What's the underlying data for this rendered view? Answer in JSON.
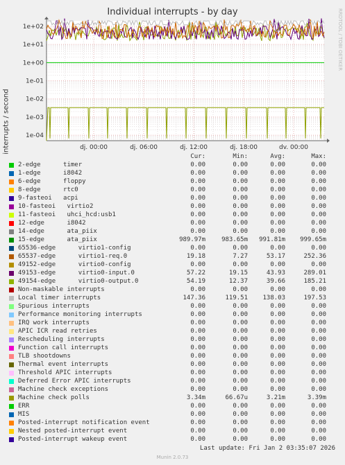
{
  "title": "Individual interrupts - by day",
  "watermark": "RRDTOOL / TOBI OETIKER",
  "ylabel": "interrupts / second",
  "footer": "Munin 2.0.73",
  "last_update": "Last update: Fri Jan  2 03:35:07 2026",
  "columns": {
    "cur": "Cur:",
    "min": "Min:",
    "avg": "Avg:",
    "max": "Max:"
  },
  "chart_data": {
    "type": "line",
    "title": "Individual interrupts - by day",
    "ylabel": "interrupts / second",
    "yscale": "log",
    "ylim": [
      5e-05,
      200
    ],
    "y_ticks": [
      "1e-04",
      "1e-03",
      "1e-02",
      "1e-01",
      "1e+00",
      "1e+01",
      "1e+02"
    ],
    "x_ticks": [
      "dj. 00:00",
      "dj. 06:00",
      "dj. 12:00",
      "dj. 18:00",
      "dv. 00:00"
    ],
    "grid": true,
    "series": [
      {
        "name": "15-edge ata_piix",
        "color": "#00cc00",
        "style": "flat",
        "value": 0.99
      },
      {
        "name": "49154-edge virtio0-output.0",
        "color": "#8fa000",
        "style": "noisy",
        "min": 12.37,
        "avg": 39.66,
        "max": 185.21
      },
      {
        "name": "49153-edge virtio0-input.0",
        "color": "#62007a",
        "style": "noisy",
        "min": 19.15,
        "avg": 43.93,
        "max": 289.01
      },
      {
        "name": "65537-edge virtio1-req.0",
        "color": "#cc6600",
        "style": "noisy",
        "min": 7.27,
        "avg": 53.17,
        "max": 252.36
      },
      {
        "name": "Local timer interrupts",
        "color": "#bbbbbb",
        "style": "noisy",
        "min": 119.51,
        "avg": 138.03,
        "max": 197.53
      },
      {
        "name": "Machine check polls",
        "color": "#8fa000",
        "style": "spiky",
        "value": 0.00334,
        "min": 6.67e-05
      }
    ]
  },
  "legend": [
    {
      "color": "#00cc00",
      "name": "2-edge      timer",
      "cur": "0.00",
      "min": "0.00",
      "avg": "0.00",
      "max": "0.00"
    },
    {
      "color": "#0066b3",
      "name": "1-edge      i8042",
      "cur": "0.00",
      "min": "0.00",
      "avg": "0.00",
      "max": "0.00"
    },
    {
      "color": "#ff8000",
      "name": "6-edge      floppy",
      "cur": "0.00",
      "min": "0.00",
      "avg": "0.00",
      "max": "0.00"
    },
    {
      "color": "#ffcc00",
      "name": "8-edge      rtc0",
      "cur": "0.00",
      "min": "0.00",
      "avg": "0.00",
      "max": "0.00"
    },
    {
      "color": "#330099",
      "name": "9-fasteoi   acpi",
      "cur": "0.00",
      "min": "0.00",
      "avg": "0.00",
      "max": "0.00"
    },
    {
      "color": "#990099",
      "name": "10-fasteoi   virtio2",
      "cur": "0.00",
      "min": "0.00",
      "avg": "0.00",
      "max": "0.00"
    },
    {
      "color": "#ccff00",
      "name": "11-fasteoi   uhci_hcd:usb1",
      "cur": "0.00",
      "min": "0.00",
      "avg": "0.00",
      "max": "0.00"
    },
    {
      "color": "#ff0000",
      "name": "12-edge      i8042",
      "cur": "0.00",
      "min": "0.00",
      "avg": "0.00",
      "max": "0.00"
    },
    {
      "color": "#808080",
      "name": "14-edge      ata_piix",
      "cur": "0.00",
      "min": "0.00",
      "avg": "0.00",
      "max": "0.00"
    },
    {
      "color": "#008f00",
      "name": "15-edge      ata_piix",
      "cur": "989.97m",
      "min": "983.65m",
      "avg": "991.81m",
      "max": "999.65m"
    },
    {
      "color": "#00487d",
      "name": "65536-edge      virtio1-config",
      "cur": "0.00",
      "min": "0.00",
      "avg": "0.00",
      "max": "0.00"
    },
    {
      "color": "#b35a00",
      "name": "65537-edge      virtio1-req.0",
      "cur": "19.18",
      "min": "7.27",
      "avg": "53.17",
      "max": "252.36"
    },
    {
      "color": "#b38f00",
      "name": "49152-edge      virtio0-config",
      "cur": "0.00",
      "min": "0.00",
      "avg": "0.00",
      "max": "0.00"
    },
    {
      "color": "#6b006b",
      "name": "49153-edge      virtio0-input.0",
      "cur": "57.22",
      "min": "19.15",
      "avg": "43.93",
      "max": "289.01"
    },
    {
      "color": "#8fb300",
      "name": "49154-edge      virtio0-output.0",
      "cur": "54.19",
      "min": "12.37",
      "avg": "39.66",
      "max": "185.21"
    },
    {
      "color": "#b30000",
      "name": "Non-maskable interrupts",
      "cur": "0.00",
      "min": "0.00",
      "avg": "0.00",
      "max": "0.00"
    },
    {
      "color": "#bebebe",
      "name": "Local timer interrupts",
      "cur": "147.36",
      "min": "119.51",
      "avg": "138.03",
      "max": "197.53"
    },
    {
      "color": "#80ff80",
      "name": "Spurious interrupts",
      "cur": "0.00",
      "min": "0.00",
      "avg": "0.00",
      "max": "0.00"
    },
    {
      "color": "#80c9ff",
      "name": "Performance monitoring interrupts",
      "cur": "0.00",
      "min": "0.00",
      "avg": "0.00",
      "max": "0.00"
    },
    {
      "color": "#ffc080",
      "name": "IRQ work interrupts",
      "cur": "0.00",
      "min": "0.00",
      "avg": "0.00",
      "max": "0.00"
    },
    {
      "color": "#ffe680",
      "name": "APIC ICR read retries",
      "cur": "0.00",
      "min": "0.00",
      "avg": "0.00",
      "max": "0.00"
    },
    {
      "color": "#aa80ff",
      "name": "Rescheduling interrupts",
      "cur": "0.00",
      "min": "0.00",
      "avg": "0.00",
      "max": "0.00"
    },
    {
      "color": "#ee00cc",
      "name": "Function call interrupts",
      "cur": "0.00",
      "min": "0.00",
      "avg": "0.00",
      "max": "0.00"
    },
    {
      "color": "#ff8080",
      "name": "TLB shootdowns",
      "cur": "0.00",
      "min": "0.00",
      "avg": "0.00",
      "max": "0.00"
    },
    {
      "color": "#666600",
      "name": "Thermal event interrupts",
      "cur": "0.00",
      "min": "0.00",
      "avg": "0.00",
      "max": "0.00"
    },
    {
      "color": "#ffbfff",
      "name": "Threshold APIC interrupts",
      "cur": "0.00",
      "min": "0.00",
      "avg": "0.00",
      "max": "0.00"
    },
    {
      "color": "#00ffcc",
      "name": "Deferred Error APIC interrupts",
      "cur": "0.00",
      "min": "0.00",
      "avg": "0.00",
      "max": "0.00"
    },
    {
      "color": "#cc6699",
      "name": "Machine check exceptions",
      "cur": "0.00",
      "min": "0.00",
      "avg": "0.00",
      "max": "0.00"
    },
    {
      "color": "#999900",
      "name": "Machine check polls",
      "cur": "3.34m",
      "min": "66.67u",
      "avg": "3.21m",
      "max": "3.39m"
    },
    {
      "color": "#00cc00",
      "name": "ERR",
      "cur": "0.00",
      "min": "0.00",
      "avg": "0.00",
      "max": "0.00"
    },
    {
      "color": "#0066b3",
      "name": "MIS",
      "cur": "0.00",
      "min": "0.00",
      "avg": "0.00",
      "max": "0.00"
    },
    {
      "color": "#ff8000",
      "name": "Posted-interrupt notification event",
      "cur": "0.00",
      "min": "0.00",
      "avg": "0.00",
      "max": "0.00"
    },
    {
      "color": "#ffcc00",
      "name": "Nested posted-interrupt event",
      "cur": "0.00",
      "min": "0.00",
      "avg": "0.00",
      "max": "0.00"
    },
    {
      "color": "#330099",
      "name": "Posted-interrupt wakeup event",
      "cur": "0.00",
      "min": "0.00",
      "avg": "0.00",
      "max": "0.00"
    }
  ]
}
